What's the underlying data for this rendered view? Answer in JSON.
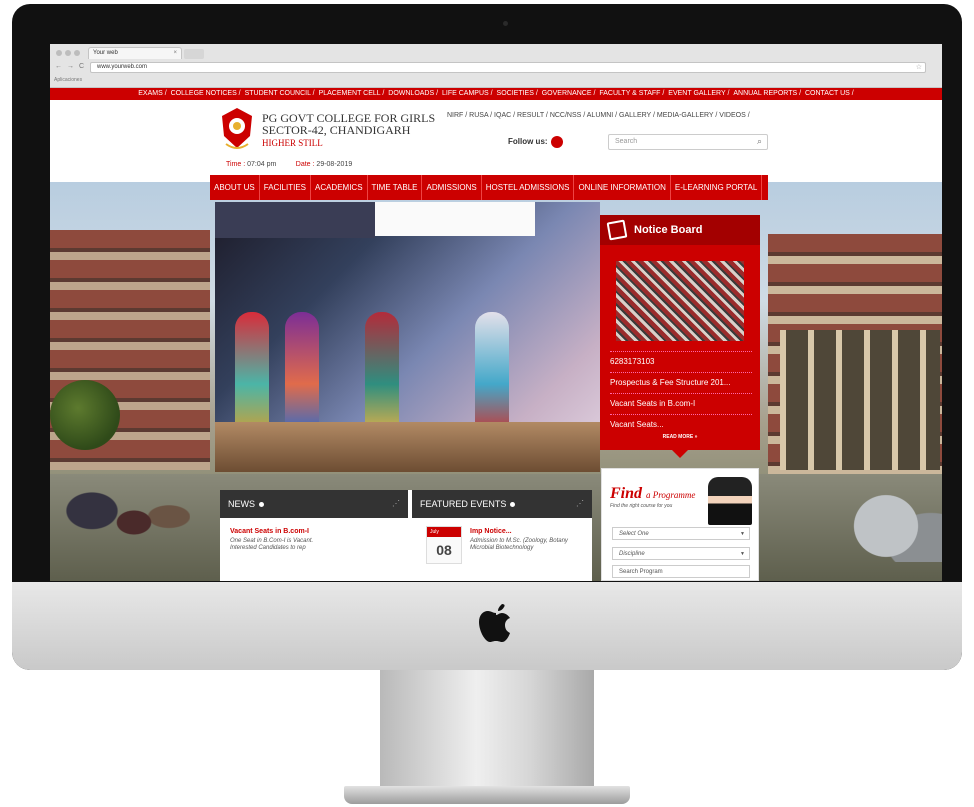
{
  "browser": {
    "tab_title": "Your web",
    "url": "www.yourweb.com",
    "bookmarks": "Aplicaciones"
  },
  "top_menu": [
    "EXAMS /",
    "COLLEGE NOTICES /",
    "STUDENT COUNCIL /",
    "PLACEMENT CELL /",
    "DOWNLOADS /",
    "LIFE CAMPUS /",
    "SOCIETIES /",
    "GOVERNANCE /",
    "FACULTY & STAFF /",
    "EVENT GALLERY /",
    "ANNUAL REPORTS /",
    "CONTACT US /"
  ],
  "header": {
    "name_line1": "PG GOVT COLLEGE FOR GIRLS",
    "name_line2": "SECTOR-42, CHANDIGARH",
    "motto": "HIGHER STILL",
    "quick_links": "NIRF /  RUSA /  IQAC /  RESULT /  NCC/NSS /  ALUMNI /  GALLERY /  MEDIA-GALLERY /  VIDEOS /",
    "follow_label": "Follow us:",
    "search_placeholder": "Search",
    "time_label": "Time :",
    "time_value": "07:04 pm",
    "date_label": "Date :",
    "date_value": "29-08-2019"
  },
  "main_nav": [
    "ABOUT US",
    "FACILITIES",
    "ACADEMICS",
    "TIME TABLE",
    "ADMISSIONS",
    "HOSTEL ADMISSIONS",
    "ONLINE INFORMATION",
    "E-LEARNING PORTAL"
  ],
  "notice_board": {
    "title": "Notice Board",
    "items": [
      "6283173103",
      "Prospectus & Fee Structure 201...",
      "Vacant Seats in B.com-I",
      "Vacant Seats..."
    ],
    "read_more": "READ MORE »"
  },
  "find_programme": {
    "title_big": "Find",
    "title_small": "a Programme",
    "subtitle": "Find the right course for you",
    "select1": "Select One",
    "select2": "Discipline",
    "search_placeholder": "Search Program"
  },
  "news": {
    "header": "NEWS",
    "title": "Vacant Seats in B.com-I",
    "body": "One Seat in B.Com-I is Vacant. Interested Candidates to rep"
  },
  "events": {
    "header": "FEATURED EVENTS",
    "month": "July",
    "day": "08",
    "title": "Imp Notice...",
    "body": "Admission to M.Sc. (Zoology, Botany Microbial Biotechnology"
  },
  "colors": {
    "brand_red": "#cc0000",
    "dark": "#333333"
  }
}
